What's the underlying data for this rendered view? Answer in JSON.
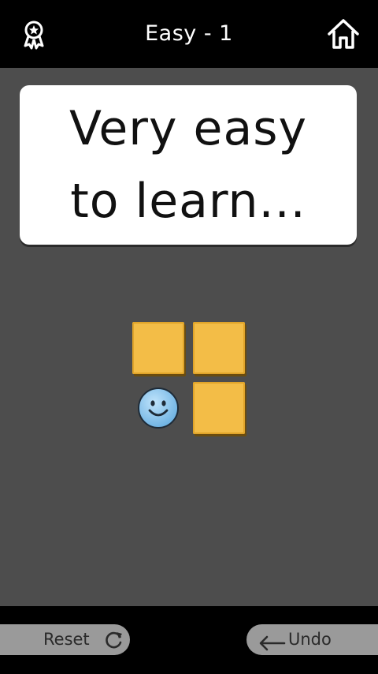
{
  "header": {
    "title": "Easy - 1",
    "left_icon": "award-ribbon-icon",
    "right_icon": "home-icon"
  },
  "message": {
    "line1": "Very easy",
    "line2": "to learn..."
  },
  "board": {
    "tiles": [
      "tile",
      "tile",
      "tile"
    ],
    "player_icon": "smiley-face-icon",
    "tile_color": "#f3bd47",
    "player_color": "#86c3ea"
  },
  "footer": {
    "reset_label": "Reset",
    "reset_icon": "refresh-icon",
    "undo_label": "Undo",
    "undo_icon": "arrow-left-icon"
  }
}
